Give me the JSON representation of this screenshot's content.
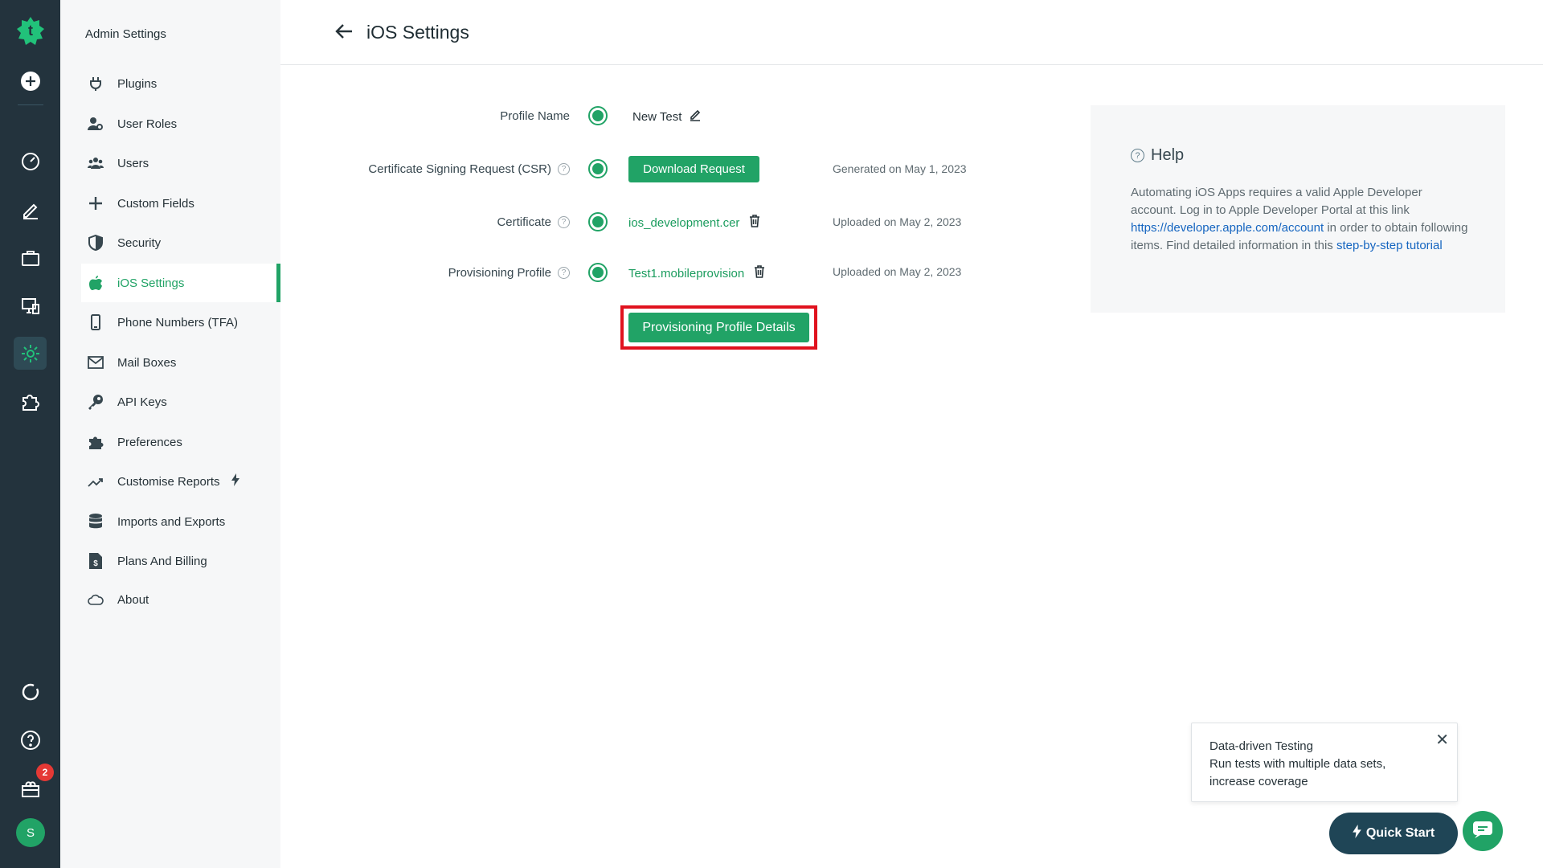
{
  "sidebar": {
    "title": "Admin Settings",
    "items": [
      {
        "label": "Plugins",
        "icon": "plug-icon"
      },
      {
        "label": "User Roles",
        "icon": "user-roles-icon"
      },
      {
        "label": "Users",
        "icon": "users-icon"
      },
      {
        "label": "Custom Fields",
        "icon": "plus-icon"
      },
      {
        "label": "Security",
        "icon": "shield-icon"
      },
      {
        "label": "iOS Settings",
        "icon": "apple-icon",
        "active": true
      },
      {
        "label": "Phone Numbers (TFA)",
        "icon": "phone-icon"
      },
      {
        "label": "Mail Boxes",
        "icon": "mail-icon"
      },
      {
        "label": "API Keys",
        "icon": "key-icon"
      },
      {
        "label": "Preferences",
        "icon": "puzzle-icon"
      },
      {
        "label": "Customise Reports",
        "icon": "trend-icon"
      },
      {
        "label": "Imports and Exports",
        "icon": "database-icon"
      },
      {
        "label": "Plans And Billing",
        "icon": "billing-icon"
      },
      {
        "label": "About",
        "icon": "cloud-icon"
      }
    ]
  },
  "rail": {
    "notification_count": "2",
    "avatar_initial": "S"
  },
  "header": {
    "title": "iOS Settings"
  },
  "form": {
    "profile_name_label": "Profile Name",
    "profile_name_value": "New Test",
    "csr_label": "Certificate Signing Request (CSR)",
    "download_button": "Download Request",
    "csr_meta": "Generated on  May 1, 2023",
    "certificate_label": "Certificate",
    "certificate_file": "ios_development.cer",
    "certificate_meta": "Uploaded on  May 2, 2023",
    "provisioning_label": "Provisioning Profile",
    "provisioning_file": "Test1.mobileprovision",
    "provisioning_meta": "Uploaded on  May 2, 2023",
    "details_button": "Provisioning Profile Details"
  },
  "help": {
    "title": "Help",
    "text_1": "Automating iOS Apps requires a valid Apple Developer account. Log in to Apple Developer Portal at this link ",
    "link_1": "https://developer.apple.com/account",
    "text_2": " in order to obtain following items. Find detailed information in this ",
    "link_2": "step-by-step tutorial"
  },
  "toast": {
    "line1": "Data-driven Testing",
    "line2": "Run tests with multiple data sets,",
    "line3": "increase coverage",
    "close": "✕"
  },
  "quick_start": "Quick Start",
  "colors": {
    "accent": "#21a366",
    "rail": "#23333d",
    "highlight": "#e0121e"
  }
}
